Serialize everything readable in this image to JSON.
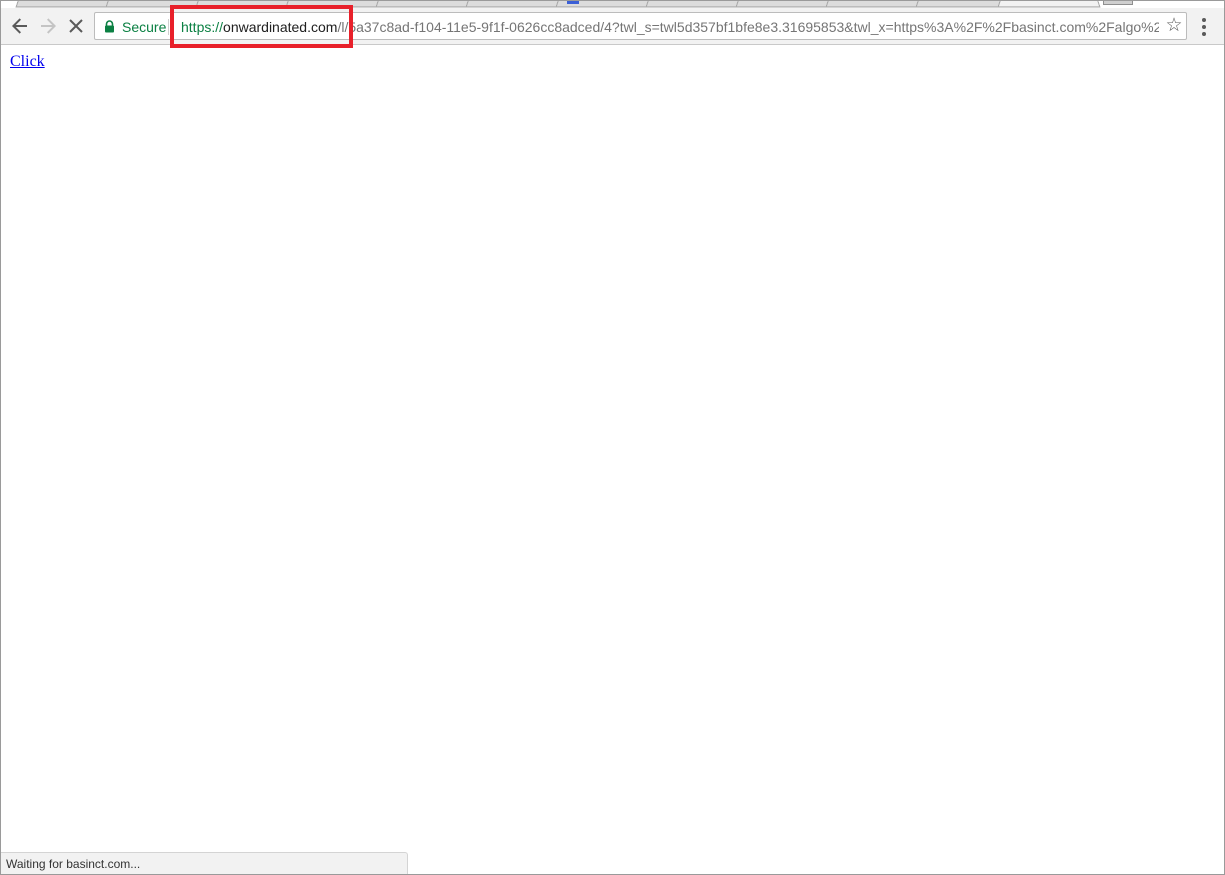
{
  "browser": {
    "omnibox": {
      "secure_label": "Secure",
      "url_scheme": "https://",
      "url_host": "onwardinated.com",
      "url_path": "/l/5a37c8ad-f104-11e5-9f1f-0626cc8adced/4?twl_s=twl5d357bf1bfe8e3.31695853&twl_x=https%3A%2F%2Fbasinct.com%2Falgo%2"
    },
    "icons": {
      "back": "back-arrow-icon",
      "forward": "forward-arrow-icon",
      "stop": "stop-loading-icon",
      "lock": "lock-icon",
      "bookmark": "star-icon",
      "menu": "kebab-menu-icon"
    },
    "colors": {
      "secure_green": "#0b8043",
      "highlight_red": "#e8202a",
      "link_blue": "#0000ee"
    }
  },
  "page": {
    "link_text": "Click"
  },
  "status_bar": {
    "text": "Waiting for basinct.com..."
  }
}
